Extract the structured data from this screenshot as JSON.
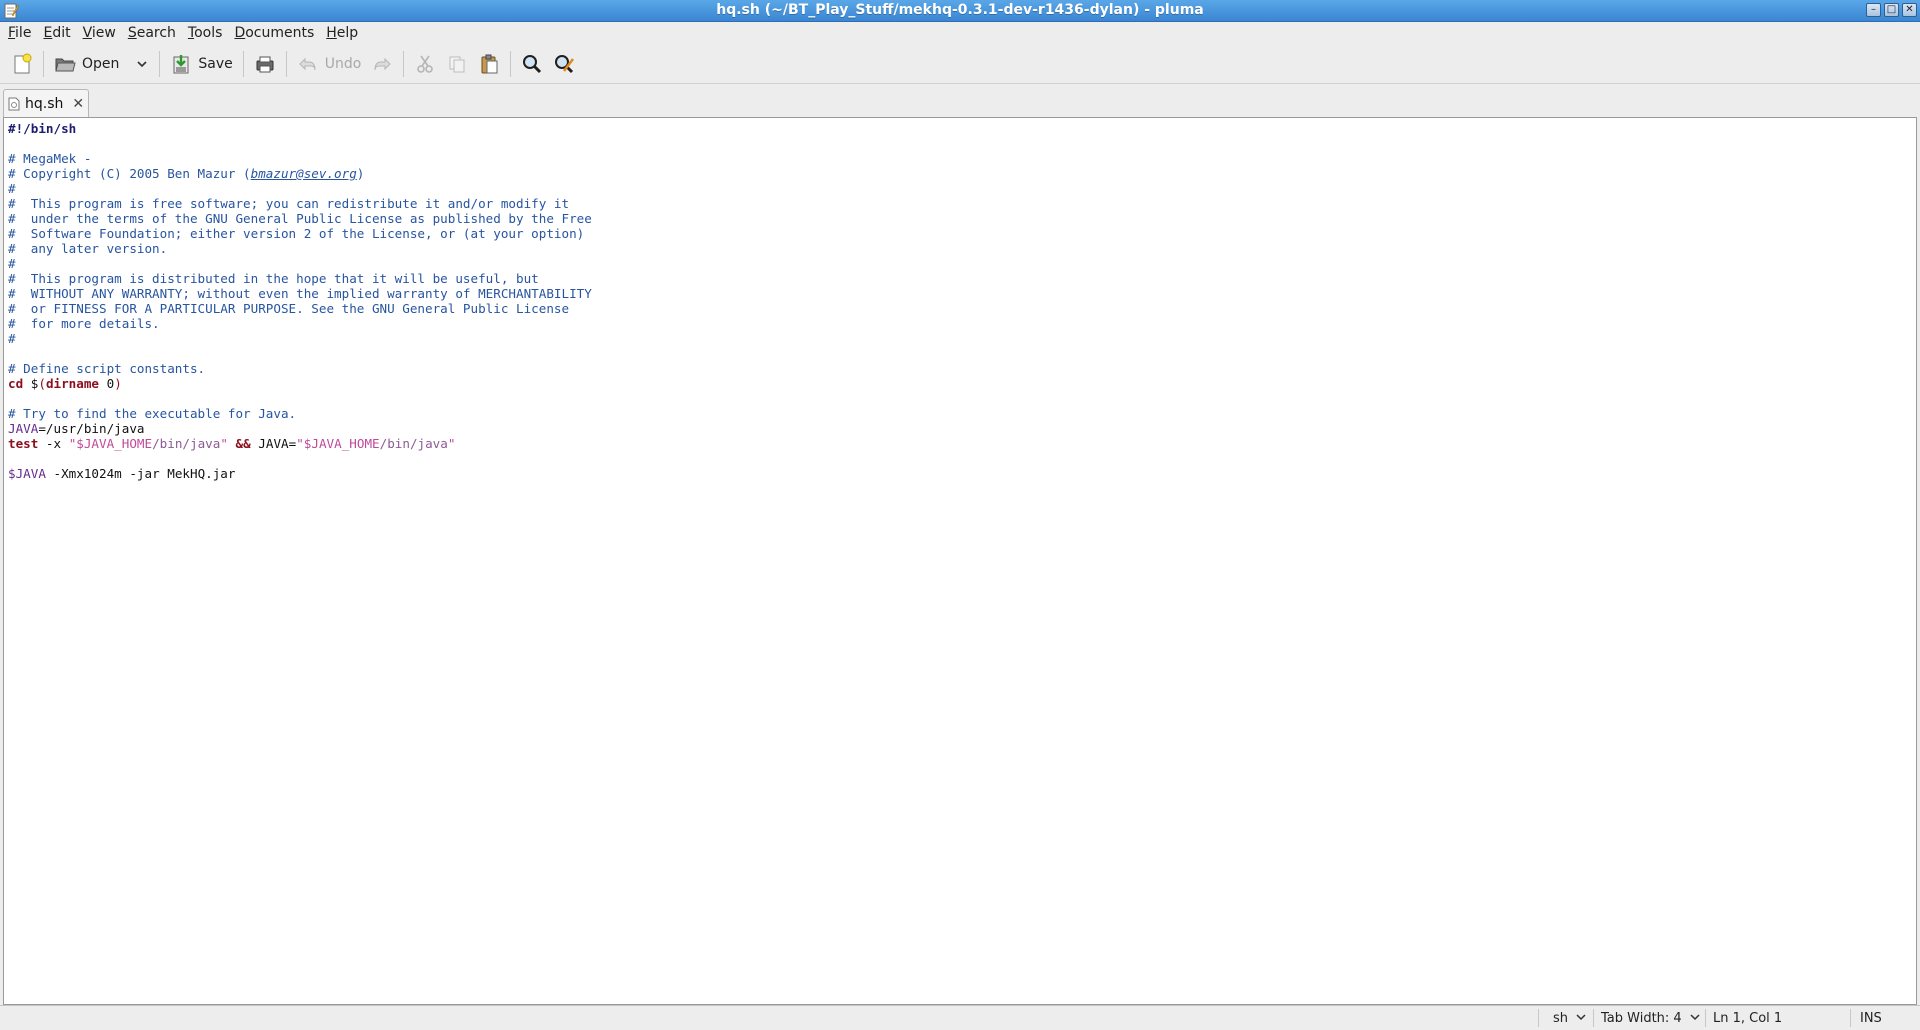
{
  "window": {
    "title": "hq.sh (~/BT_Play_Stuff/mekhq-0.3.1-dev-r1436-dylan) - pluma",
    "app_icon": "pluma-notepad-icon",
    "buttons": {
      "minimize": "–",
      "maximize": "□",
      "close": "✕"
    }
  },
  "menubar": {
    "items": [
      {
        "label": "File",
        "mnemonic": "F",
        "rest": "ile"
      },
      {
        "label": "Edit",
        "mnemonic": "E",
        "rest": "dit"
      },
      {
        "label": "View",
        "mnemonic": "V",
        "rest": "iew"
      },
      {
        "label": "Search",
        "mnemonic": "S",
        "rest": "earch"
      },
      {
        "label": "Tools",
        "mnemonic": "T",
        "rest": "ools"
      },
      {
        "label": "Documents",
        "mnemonic": "D",
        "rest": "ocuments"
      },
      {
        "label": "Help",
        "mnemonic": "H",
        "rest": "elp"
      }
    ]
  },
  "toolbar": {
    "new_icon": "new-document-icon",
    "open_label": "Open",
    "save_label": "Save",
    "print_icon": "print-icon",
    "undo_label": "Undo",
    "redo_icon": "redo-icon",
    "cut_icon": "cut-icon",
    "copy_icon": "copy-icon",
    "paste_icon": "paste-icon",
    "find_icon": "search-icon",
    "replace_icon": "find-replace-icon"
  },
  "tabs": [
    {
      "label": "hq.sh",
      "close": "✕"
    }
  ],
  "editor": {
    "lines": [
      [
        {
          "t": "#!/bin/sh",
          "c": "shebang"
        }
      ],
      [],
      [
        {
          "t": "# MegaMek -",
          "c": "comment"
        }
      ],
      [
        {
          "t": "# Copyright (C) 2005 Ben Mazur (",
          "c": "comment"
        },
        {
          "t": "bmazur@sev.org",
          "c": "comment-email"
        },
        {
          "t": ")",
          "c": "comment"
        }
      ],
      [
        {
          "t": "#",
          "c": "comment"
        }
      ],
      [
        {
          "t": "#  This program is free software; you can redistribute it and/or modify it",
          "c": "comment"
        }
      ],
      [
        {
          "t": "#  under the terms of the GNU General Public License as published by the Free",
          "c": "comment"
        }
      ],
      [
        {
          "t": "#  Software Foundation; either version 2 of the License, or (at your option)",
          "c": "comment"
        }
      ],
      [
        {
          "t": "#  any later version.",
          "c": "comment"
        }
      ],
      [
        {
          "t": "#",
          "c": "comment"
        }
      ],
      [
        {
          "t": "#  This program is distributed in the hope that it will be useful, but",
          "c": "comment"
        }
      ],
      [
        {
          "t": "#  WITHOUT ANY WARRANTY; without even the implied warranty of MERCHANTABILITY",
          "c": "comment"
        }
      ],
      [
        {
          "t": "#  or FITNESS FOR A PARTICULAR PURPOSE. See the GNU General Public License",
          "c": "comment"
        }
      ],
      [
        {
          "t": "#  for more details.",
          "c": "comment"
        }
      ],
      [
        {
          "t": "#",
          "c": "comment"
        }
      ],
      [],
      [
        {
          "t": "# Define script constants.",
          "c": "comment"
        }
      ],
      [
        {
          "t": "cd",
          "c": "keyword"
        },
        {
          "t": " $",
          "c": "plain"
        },
        {
          "t": "(",
          "c": "builtin"
        },
        {
          "t": "dirname",
          "c": "keyword"
        },
        {
          "t": " 0",
          "c": "plain"
        },
        {
          "t": ")",
          "c": "builtin"
        }
      ],
      [],
      [
        {
          "t": "# Try to find the executable for Java.",
          "c": "comment"
        }
      ],
      [
        {
          "t": "JAVA",
          "c": "variable"
        },
        {
          "t": "=/usr/bin/java",
          "c": "plain"
        }
      ],
      [
        {
          "t": "test",
          "c": "keyword"
        },
        {
          "t": " -x ",
          "c": "plain"
        },
        {
          "t": "\"$JAVA_HOME",
          "c": "strval"
        },
        {
          "t": "/bin/java",
          "c": "strpath"
        },
        {
          "t": "\"",
          "c": "strval"
        },
        {
          "t": " ",
          "c": "plain"
        },
        {
          "t": "&&",
          "c": "keyword"
        },
        {
          "t": " JAVA=",
          "c": "plain"
        },
        {
          "t": "\"$JAVA_HOME",
          "c": "strval"
        },
        {
          "t": "/bin/java",
          "c": "strpath"
        },
        {
          "t": "\"",
          "c": "strval"
        }
      ],
      [],
      [
        {
          "t": "$JAVA",
          "c": "variable"
        },
        {
          "t": " -Xmx1024m -jar MekHQ.jar",
          "c": "plain"
        }
      ]
    ]
  },
  "statusbar": {
    "language": "sh",
    "tab_width": "Tab Width: 4",
    "position": "Ln 1, Col 1",
    "mode": "INS"
  }
}
